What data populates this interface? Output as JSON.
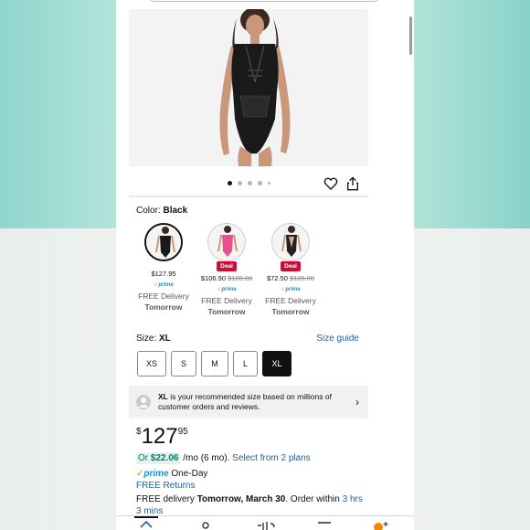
{
  "colors": {
    "accent_link": "#2162a1",
    "deal_red": "#cc0c39",
    "prime_blue": "#1d8fd1",
    "selected_dark": "#111111"
  },
  "gallery": {
    "dot_count": 5,
    "active_index": 0
  },
  "icons": {
    "favorite": "heart-icon",
    "share": "share-icon"
  },
  "color_selector": {
    "label": "Color:",
    "selected": "Black",
    "swatches": [
      {
        "price": "$127.95",
        "strike": "",
        "deal": "",
        "prime": "prime",
        "delivery": "FREE Delivery",
        "day": "Tomorrow"
      },
      {
        "price": "$106.90",
        "strike": "$128.00",
        "deal": "Deal",
        "prime": "prime",
        "delivery": "FREE Delivery",
        "day": "Tomorrow"
      },
      {
        "price": "$72.50",
        "strike": "$128.00",
        "deal": "Deal",
        "prime": "prime",
        "delivery": "FREE Delivery",
        "day": "Tomorrow"
      }
    ]
  },
  "size_selector": {
    "label": "Size:",
    "selected": "XL",
    "guide": "Size guide",
    "sizes": [
      "XS",
      "S",
      "M",
      "L",
      "XL"
    ]
  },
  "recommendation": {
    "size": "XL",
    "text": " is your recommended size based on millions of customer orders and reviews."
  },
  "price": {
    "currency": "$",
    "whole": "127",
    "fraction": "95"
  },
  "installments": {
    "or": "Or ",
    "amount": "$22.06",
    "term": " /mo (6 mo). ",
    "link": "Select from 2 plans"
  },
  "prime_line": {
    "check": "✓",
    "prime": "prime",
    "speed": " One-Day"
  },
  "returns": "FREE Returns",
  "delivery": {
    "prefix": "FREE delivery ",
    "date": "Tomorrow, March 30",
    "middle": ". Order within ",
    "countdown": "3 hrs 3 mins"
  }
}
